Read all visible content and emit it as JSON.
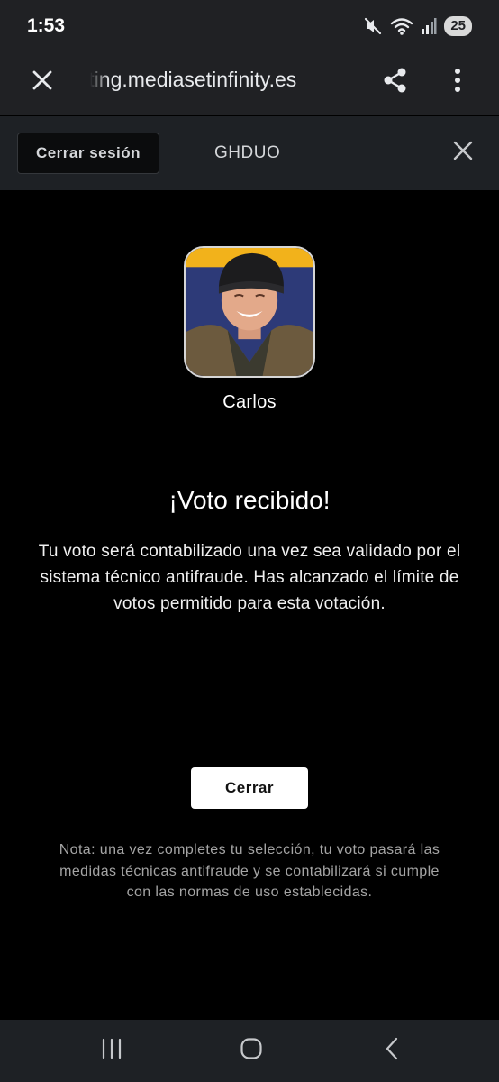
{
  "status_bar": {
    "time": "1:53",
    "battery_level": "25",
    "icons": [
      "mute-icon",
      "wifi-icon",
      "signal-icon"
    ]
  },
  "browser": {
    "url": "voting.mediasetinfinity.es",
    "close_icon": "close-icon",
    "share_icon": "share-icon",
    "menu_icon": "more-vert-icon"
  },
  "site_header": {
    "logout_label": "Cerrar sesión",
    "user_code": "GHDUO",
    "close_icon": "close-icon"
  },
  "contestant": {
    "name": "Carlos"
  },
  "confirmation": {
    "title": "¡Voto recibido!",
    "message": "Tu voto será contabilizado una vez sea validado por el sistema técnico antifraude. Has alcanzado el límite de votos permitido para esta votación.",
    "close_label": "Cerrar",
    "disclaimer": "Nota: una vez completes tu selección, tu voto pasará las medidas técnicas antifraude y se contabilizará si cumple con las normas de uso establecidas."
  },
  "nav_bar": {
    "icons": [
      "recents-icon",
      "home-icon",
      "back-icon"
    ]
  },
  "colors": {
    "page_background": "#000000",
    "chrome_background": "#202124",
    "header_background": "#1e2125",
    "button_background": "#ffffff",
    "avatar_background": "#26336b",
    "disclaimer_text": "#a4a4a4"
  }
}
